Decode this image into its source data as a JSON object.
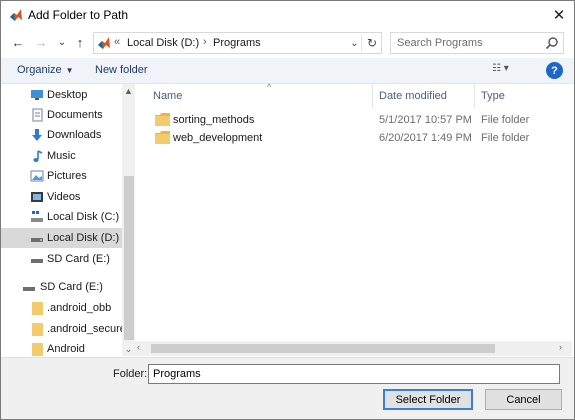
{
  "window": {
    "title": "Add Folder to Path",
    "close_glyph": "✕"
  },
  "nav": {
    "back_glyph": "←",
    "forward_glyph": "→",
    "recent_glyph": "⌄",
    "up_glyph": "↑"
  },
  "address": {
    "overflow": "«",
    "crumb1": "Local Disk (D:)",
    "separator": "›",
    "crumb2": "Programs",
    "dropdown_glyph": "⌄",
    "refresh_glyph": "↻"
  },
  "search": {
    "placeholder": "Search Programs"
  },
  "toolbar": {
    "organize": "Organize",
    "organize_arrow": "▼",
    "new_folder": "New folder",
    "view_glyph": "☷ ▾",
    "help_glyph": "?"
  },
  "sidebar": {
    "items": [
      {
        "label": "Desktop",
        "icon": "desktop-icon"
      },
      {
        "label": "Documents",
        "icon": "documents-icon"
      },
      {
        "label": "Downloads",
        "icon": "downloads-icon"
      },
      {
        "label": "Music",
        "icon": "music-icon"
      },
      {
        "label": "Pictures",
        "icon": "pictures-icon"
      },
      {
        "label": "Videos",
        "icon": "videos-icon"
      },
      {
        "label": "Local Disk (C:)",
        "icon": "drive-icon"
      },
      {
        "label": "Local Disk (D:)",
        "icon": "drive-icon",
        "selected": true
      },
      {
        "label": "SD Card (E:)",
        "icon": "sd-card-icon"
      },
      {
        "label": "SD Card (E:)",
        "icon": "sd-card-icon"
      },
      {
        "label": ".android_obb",
        "icon": "folder-icon"
      },
      {
        "label": ".android_secure",
        "icon": "folder-icon"
      },
      {
        "label": "Android",
        "icon": "folder-icon"
      }
    ],
    "scroll_up_glyph": "▲",
    "scroll_down_glyph": "⌄"
  },
  "columns": {
    "name": "Name",
    "date": "Date modified",
    "type": "Type",
    "sort_glyph": "^"
  },
  "files": [
    {
      "name": "sorting_methods",
      "date": "5/1/2017 10:57 PM",
      "type": "File folder"
    },
    {
      "name": "web_development",
      "date": "6/20/2017 1:49 PM",
      "type": "File folder"
    }
  ],
  "hscroll": {
    "left_glyph": "‹",
    "right_glyph": "›"
  },
  "footer": {
    "folder_label": "Folder:",
    "folder_value": "Programs",
    "select_button": "Select Folder",
    "cancel_button": "Cancel"
  },
  "colors": {
    "accent": "#1c67c8",
    "folder": "#e8b94a",
    "selection": "#d9d9d9"
  }
}
